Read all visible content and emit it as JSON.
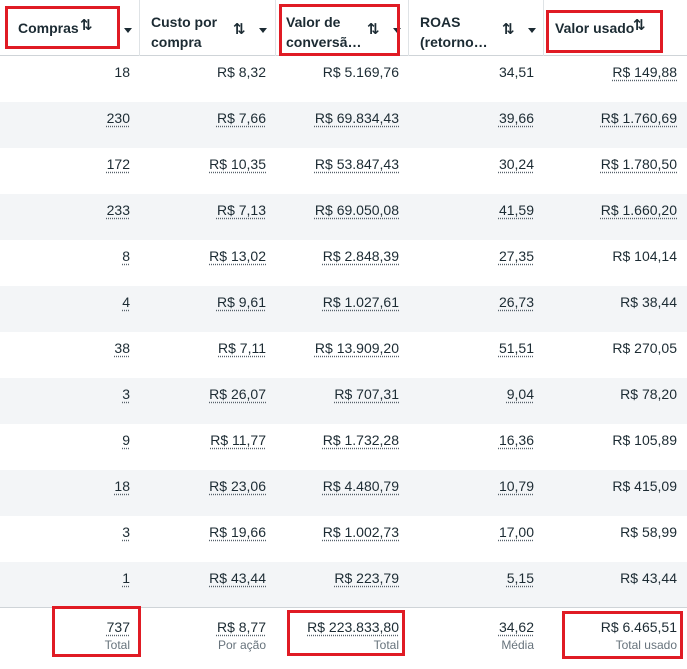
{
  "columns": [
    {
      "label": "Compras",
      "subtotal": "737",
      "subtotal_label": "Total"
    },
    {
      "label": "Custo por\ncompra",
      "subtotal": "R$ 8,77",
      "subtotal_label": "Por ação"
    },
    {
      "label": "Valor de\nconversã…",
      "subtotal": "R$ 223.833,80",
      "subtotal_label": "Total"
    },
    {
      "label": "ROAS\n(retorno…",
      "subtotal": "34,62",
      "subtotal_label": "Média"
    },
    {
      "label": "Valor usado",
      "subtotal": "R$ 6.465,51",
      "subtotal_label": "Total usado"
    }
  ],
  "rows": [
    [
      "18",
      "R$ 8,32",
      "R$ 5.169,76",
      "34,51",
      "R$ 149,88"
    ],
    [
      "230",
      "R$ 7,66",
      "R$ 69.834,43",
      "39,66",
      "R$ 1.760,69"
    ],
    [
      "172",
      "R$ 10,35",
      "R$ 53.847,43",
      "30,24",
      "R$ 1.780,50"
    ],
    [
      "233",
      "R$ 7,13",
      "R$ 69.050,08",
      "41,59",
      "R$ 1.660,20"
    ],
    [
      "8",
      "R$ 13,02",
      "R$ 2.848,39",
      "27,35",
      "R$ 104,14"
    ],
    [
      "4",
      "R$ 9,61",
      "R$ 1.027,61",
      "26,73",
      "R$ 38,44"
    ],
    [
      "38",
      "R$ 7,11",
      "R$ 13.909,20",
      "51,51",
      "R$ 270,05"
    ],
    [
      "3",
      "R$ 26,07",
      "R$ 707,31",
      "9,04",
      "R$ 78,20"
    ],
    [
      "9",
      "R$ 11,77",
      "R$ 1.732,28",
      "16,36",
      "R$ 105,89"
    ],
    [
      "18",
      "R$ 23,06",
      "R$ 4.480,79",
      "10,79",
      "R$ 415,09"
    ],
    [
      "3",
      "R$ 19,66",
      "R$ 1.002,73",
      "17,00",
      "R$ 58,99"
    ],
    [
      "1",
      "R$ 43,44",
      "R$ 223,79",
      "5,15",
      "R$ 43,44"
    ]
  ],
  "icons": {
    "sort": "sort-arrows-icon",
    "menu": "caret-down-icon"
  },
  "colors": {
    "highlight": "#e01b24",
    "alt_row": "#f3f5f7",
    "text": "#1c2b33",
    "muted": "#67737c"
  }
}
